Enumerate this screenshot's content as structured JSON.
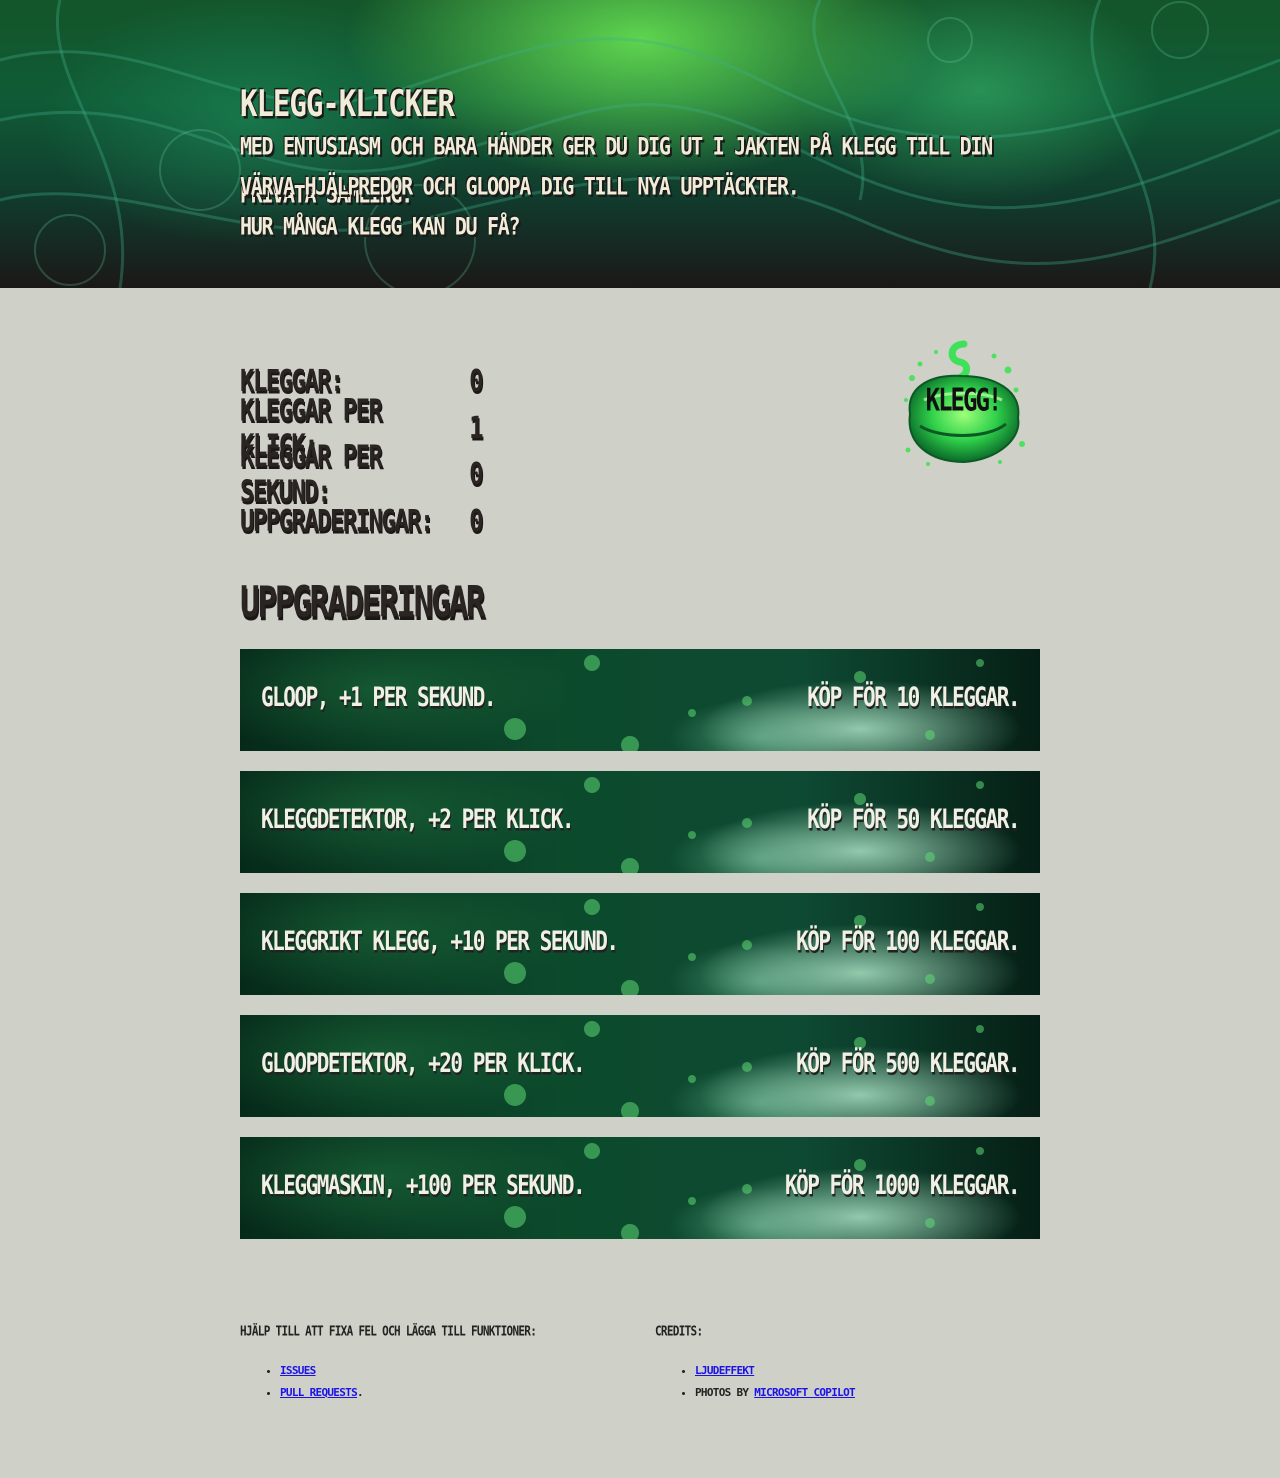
{
  "header": {
    "title": "Klegg-klicker",
    "lines": [
      "Med entusiasm och bara händer ger du dig ut i jakten på klegg till din privata samling.",
      "Värva hjälpredor och gloopa dig till nya upptäckter.",
      "Hur många klegg kan du få?"
    ]
  },
  "stats": [
    {
      "label": "Kleggar:",
      "value": "0"
    },
    {
      "label": "Kleggar per klick:",
      "value": "1"
    },
    {
      "label": "Kleggar per sekund:",
      "value": "0"
    },
    {
      "label": "Uppgraderingar:",
      "value": "0"
    }
  ],
  "klegg_button": {
    "label": "Klegg!"
  },
  "upgrades_heading": "Uppgraderingar",
  "upgrades": [
    {
      "name": "Gloop, +1 per sekund.",
      "price": "Köp för 10 kleggar."
    },
    {
      "name": "Kleggdetektor, +2 per klick.",
      "price": "Köp för 50 kleggar."
    },
    {
      "name": "Kleggrikt klegg, +10 per sekund.",
      "price": "Köp för 100 kleggar."
    },
    {
      "name": "Gloopdetektor, +20 per klick.",
      "price": "Köp för 500 kleggar."
    },
    {
      "name": "Kleggmaskin, +100 per sekund.",
      "price": "Köp för 1000 kleggar."
    }
  ],
  "footer": {
    "help": {
      "title": "Hjälp till att fixa fel och lägga till funktioner:",
      "links": [
        "Issues",
        "Pull requests"
      ],
      "trailing": "."
    },
    "credits": {
      "title": "Credits:",
      "sound_link": "Ljudeffekt",
      "photos_prefix": "Photos by ",
      "photos_link": "Microsoft Copilot"
    }
  },
  "colors": {
    "page_background": "#cfd1c9",
    "header_text": "#f1ecd8",
    "link": "#1a12e8",
    "slime_green": "#2fd04a"
  }
}
